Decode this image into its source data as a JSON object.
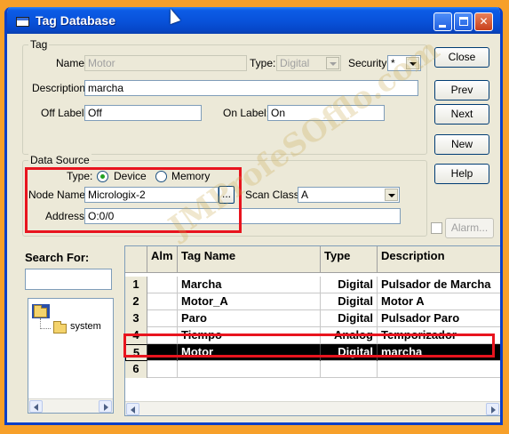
{
  "window": {
    "title": "Tag Database",
    "controls": {
      "minimize": "minimize",
      "maximize": "maximize",
      "close": "✕"
    }
  },
  "tag": {
    "group_title": "Tag",
    "name_label": "Name:",
    "name_value": "Motor",
    "type_label": "Type:",
    "type_value": "Digital",
    "security_label": "Security:",
    "security_value": "*",
    "description_label": "Description:",
    "description_value": "marcha",
    "off_label_label": "Off Label:",
    "off_label_value": "Off",
    "on_label_label": "On Label:",
    "on_label_value": "On"
  },
  "data_source": {
    "group_title": "Data Source",
    "type_label": "Type:",
    "device_label": "Device",
    "memory_label": "Memory",
    "selected": "Device",
    "node_name_label": "Node Name:",
    "node_name_value": "Micrologix-2",
    "browse_label": "...",
    "scan_class_label": "Scan Class:",
    "scan_class_value": "A",
    "address_label": "Address:",
    "address_value": "O:0/0"
  },
  "buttons": {
    "close": "Close",
    "prev": "Prev",
    "next": "Next",
    "new": "New",
    "help": "Help",
    "alarm": "Alarm..."
  },
  "search": {
    "label": "Search For:",
    "value": ""
  },
  "tree": {
    "root_icon": "folder-open-icon",
    "items": [
      {
        "label": "system",
        "icon": "folder-icon"
      }
    ]
  },
  "grid": {
    "columns": [
      "Alm",
      "Tag Name",
      "Type",
      "Description"
    ],
    "rows": [
      {
        "num": "1",
        "alm": "",
        "tag": "Marcha",
        "type": "Digital",
        "desc": "Pulsador de Marcha"
      },
      {
        "num": "2",
        "alm": "",
        "tag": "Motor_A",
        "type": "Digital",
        "desc": "Motor A"
      },
      {
        "num": "3",
        "alm": "",
        "tag": "Paro",
        "type": "Digital",
        "desc": "Pulsador Paro"
      },
      {
        "num": "4",
        "alm": "",
        "tag": "Tiempo",
        "type": "Analog",
        "desc": "Temporizador"
      },
      {
        "num": "5",
        "alm": "",
        "tag": "Motor",
        "type": "Digital",
        "desc": "marcha"
      },
      {
        "num": "6",
        "alm": "",
        "tag": "",
        "type": "",
        "desc": ""
      }
    ],
    "selected_row": 5
  },
  "watermark": "JMProfeSOfflo.com",
  "colors": {
    "titlebar": "#0851d9",
    "highlight": "#e8141e",
    "selected_row": "#000000",
    "background": "#f7a02a"
  }
}
